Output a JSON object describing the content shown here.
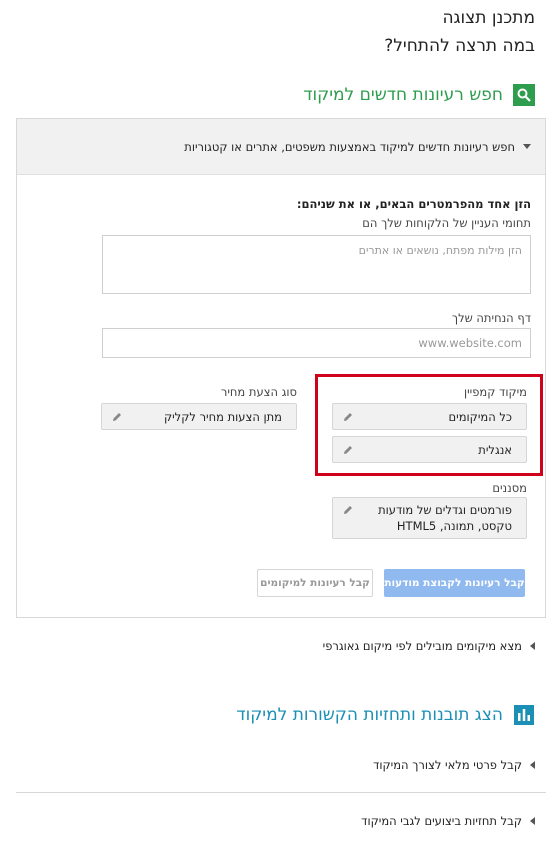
{
  "header": {
    "title": "מתכנן תצוגה",
    "subtitle": "במה תרצה להתחיל?"
  },
  "section1": {
    "title": "חפש רעיונות חדשים למיקוד",
    "icon": "search-icon",
    "accent": "#2e9d4e"
  },
  "panel": {
    "head_label": "חפש רעיונות חדשים למיקוד באמצעות משפטים, אתרים או קטגוריות",
    "instruction": "הזן אחד מהפרמטרים הבאים, או את שניהם:",
    "interests_label": "תחומי העניין של הלקוחות שלך הם",
    "interests_placeholder": "הזן מילות מפתח, נושאים או אתרים",
    "landing_label": "דף הנחיתה שלך",
    "landing_placeholder": "www.website.com",
    "targeting_label": "מיקוד קמפיין",
    "locations_value": "כל המיקומים",
    "language_value": "אנגלית",
    "bid_label": "סוג הצעת מחיר",
    "bid_value": "מתן הצעות מחיר לקליק",
    "filters_label": "מסננים",
    "filters_line1": "פורמטים וגדלים של מודעות",
    "filters_line2": "טקסט, תמונה, HTML5",
    "btn_adgroup": "קבל רעיונות לקבוצת מודעות",
    "btn_placements": "קבל רעיונות למיקומים"
  },
  "geo_link": "מצא מיקומים מובילים לפי מיקום גאוגרפי",
  "section2": {
    "title": "הצג תובנות ותחזיות הקשורות למיקוד",
    "icon": "bar-chart-icon",
    "accent": "#1b8fb6"
  },
  "link_details": "קבל פרטי מלאי לצורך המיקוד",
  "link_forecasts": "קבל תחזיות ביצועים לגבי המיקוד",
  "highlight_color": "#d0021b"
}
